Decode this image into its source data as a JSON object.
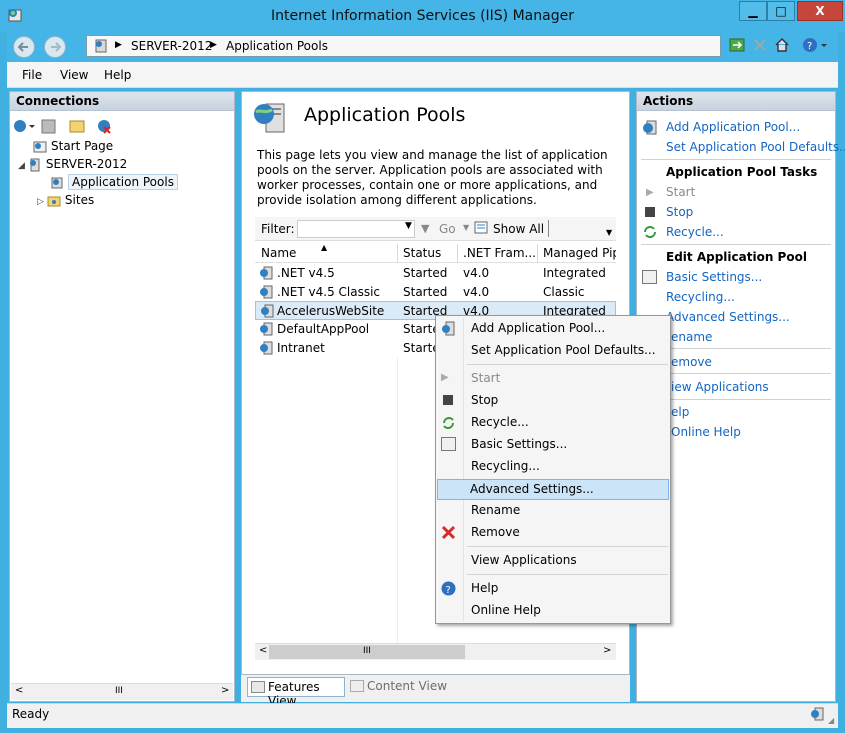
{
  "window": {
    "title": "Internet Information Services (IIS) Manager",
    "minimize_glyph": "▁",
    "maximize_glyph": "□",
    "close_glyph": "X"
  },
  "address": {
    "sep1": "▶",
    "server": "SERVER-2012",
    "sep2": "▶",
    "page": "Application Pools"
  },
  "menu": {
    "file": "File",
    "view": "View",
    "help": "Help"
  },
  "connections": {
    "header": "Connections",
    "tree": {
      "start_page": "Start Page",
      "server": "SERVER-2012",
      "app_pools": "Application Pools",
      "sites": "Sites"
    },
    "hscroll_grip": "III"
  },
  "center": {
    "heading": "Application Pools",
    "description": "This page lets you view and manage the list of application pools on the server. Application pools are associated with worker processes, contain one or more applications, and provide isolation among different applications.",
    "filter_label": "Filter:",
    "go_label": "Go",
    "show_all_label": "Show All",
    "columns": [
      "Name",
      "Status",
      ".NET Fram...",
      "Managed Pipe"
    ],
    "rows": [
      {
        "name": ".NET v4.5",
        "status": "Started",
        "net": "v4.0",
        "pipeline": "Integrated"
      },
      {
        "name": ".NET v4.5 Classic",
        "status": "Started",
        "net": "v4.0",
        "pipeline": "Classic"
      },
      {
        "name": "AccelerusWebSite",
        "status": "Started",
        "net": "v4.0",
        "pipeline": "Integrated"
      },
      {
        "name": "DefaultAppPool",
        "status": "Starte",
        "net": "",
        "pipeline": ""
      },
      {
        "name": "Intranet",
        "status": "Starte",
        "net": "",
        "pipeline": ""
      }
    ],
    "hscroll_grip": "III",
    "features_view": "Features View",
    "content_view": "Content View"
  },
  "actions": {
    "header": "Actions",
    "add_pool": "Add Application Pool...",
    "set_defaults": "Set Application Pool Defaults...",
    "tasks_header": "Application Pool Tasks",
    "start": "Start",
    "stop": "Stop",
    "recycle": "Recycle...",
    "edit_header": "Edit Application Pool",
    "basic_settings": "Basic Settings...",
    "recycling": "Recycling...",
    "advanced_settings": "Advanced Settings...",
    "rename": "ename",
    "remove": "emove",
    "view_apps": "iew Applications",
    "help": "elp",
    "online_help": "Online Help"
  },
  "context_menu": {
    "add_pool": "Add Application Pool...",
    "set_defaults": "Set Application Pool Defaults...",
    "start": "Start",
    "stop": "Stop",
    "recycle": "Recycle...",
    "basic_settings": "Basic Settings...",
    "recycling": "Recycling...",
    "advanced_settings": "Advanced Settings...",
    "rename": "Rename",
    "remove": "Remove",
    "view_apps": "View Applications",
    "help": "Help",
    "online_help": "Online Help"
  },
  "status": {
    "text": "Ready"
  },
  "colors": {
    "titlebar": "#45b4e6",
    "close_button": "#c7463c",
    "link": "#1565c0",
    "selection": "#cce4f7"
  }
}
